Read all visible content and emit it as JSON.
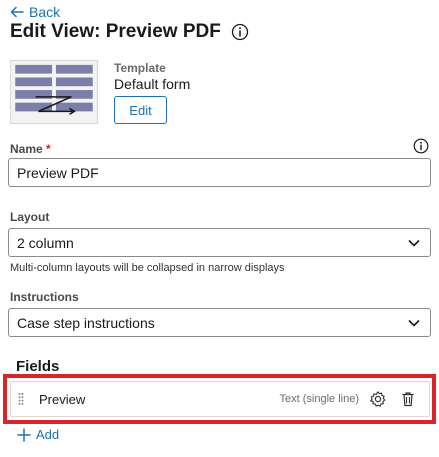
{
  "header": {
    "back_label": "Back",
    "title": "Edit View: Preview PDF"
  },
  "template": {
    "label": "Template",
    "value": "Default form",
    "edit_label": "Edit"
  },
  "name_field": {
    "label": "Name",
    "required_mark": "*",
    "value": "Preview PDF"
  },
  "layout_field": {
    "label": "Layout",
    "value": "2 column",
    "hint": "Multi-column layouts will be collapsed in narrow displays"
  },
  "instructions_field": {
    "label": "Instructions",
    "value": "Case step instructions"
  },
  "fields_section": {
    "heading": "Fields",
    "items": [
      {
        "label": "Preview",
        "type": "Text (single line)"
      }
    ],
    "add_label": "Add"
  },
  "colors": {
    "accent": "#1f6fb5",
    "highlight": "#d6252b",
    "required": "#c62828"
  },
  "icons": [
    "arrow-left-icon",
    "info-icon",
    "template-layout-icon",
    "chevron-down-icon",
    "drag-handle-icon",
    "gear-icon",
    "trash-icon",
    "plus-icon"
  ]
}
